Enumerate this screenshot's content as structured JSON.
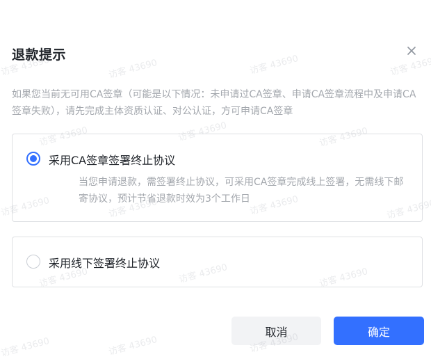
{
  "dialog": {
    "title": "退款提示",
    "description": "如果您当前无可用CA签章（可能是以下情况：未申请过CA签章、申请CA签章流程中及申请CA签章失败），请先完成主体资质认证、对公认证，方可申请CA签章",
    "options": [
      {
        "label": "采用CA签章签署终止协议",
        "description": "当您申请退款，需签署终止协议，可采用CA签章完成线上签署，无需线下邮寄协议，预计节省退款时效为3个工作日",
        "selected": true
      },
      {
        "label": "采用线下签署终止协议",
        "selected": false
      }
    ],
    "cancel_label": "取消",
    "confirm_label": "确定"
  },
  "watermark": {
    "text": "访客 43690"
  },
  "colors": {
    "accent": "#3370ff",
    "muted_text": "#a3a7ad",
    "border": "#dee0e3"
  }
}
